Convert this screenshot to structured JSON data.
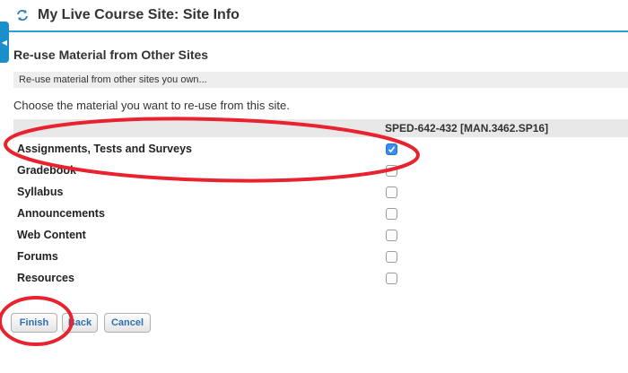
{
  "header": {
    "title": "My Live Course Site: Site Info"
  },
  "section_title": "Re-use Material from Other Sites",
  "info_text": "Re-use material from other sites you own...",
  "instruction": "Choose the material you want to re-use from this site.",
  "column_header": "SPED-642-432 [MAN.3462.SP16]",
  "tools": [
    {
      "label": "Assignments, Tests and Surveys",
      "checked": true
    },
    {
      "label": "Gradebook",
      "checked": false
    },
    {
      "label": "Syllabus",
      "checked": false
    },
    {
      "label": "Announcements",
      "checked": false
    },
    {
      "label": "Web Content",
      "checked": false
    },
    {
      "label": "Forums",
      "checked": false
    },
    {
      "label": "Resources",
      "checked": false
    }
  ],
  "buttons": {
    "finish": "Finish",
    "back": "Back",
    "cancel": "Cancel"
  },
  "colors": {
    "accent": "#2a9ed8",
    "annotation": "#e8222e",
    "checkbox_checked": "#3b8cf0"
  }
}
